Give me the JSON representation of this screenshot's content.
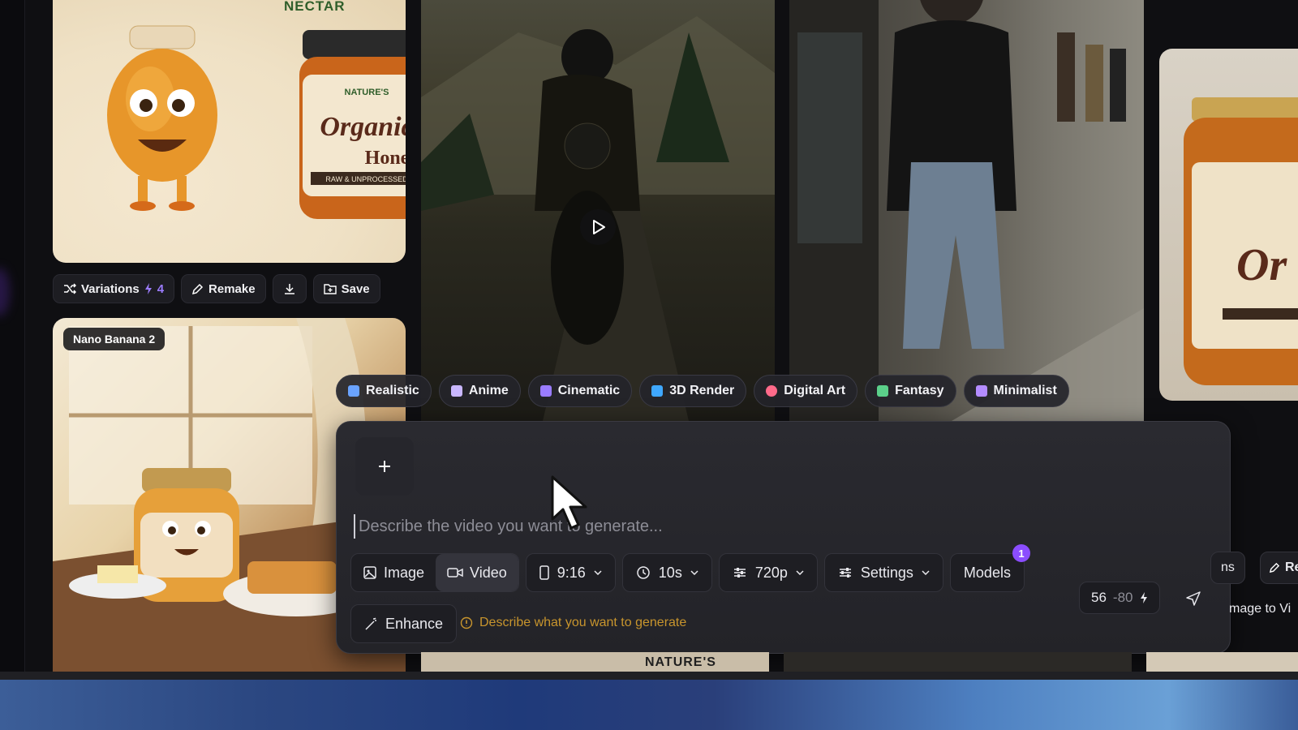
{
  "gallery": {
    "card1": {
      "brand": "NECTAR"
    },
    "card5": {
      "model_badge": "Nano Banana 2"
    }
  },
  "actions": {
    "variations_label": "Variations",
    "variations_count": "4",
    "remake_label": "Remake",
    "save_label": "Save"
  },
  "styles": [
    {
      "label": "Realistic",
      "color": "#6aa3ff"
    },
    {
      "label": "Anime",
      "color": "#c9b7ff"
    },
    {
      "label": "Cinematic",
      "color": "#9a7cff"
    },
    {
      "label": "3D Render",
      "color": "#3fa8ff"
    },
    {
      "label": "Digital Art",
      "color": "#ff6a8a"
    },
    {
      "label": "Fantasy",
      "color": "#5bd08a"
    },
    {
      "label": "Minimalist",
      "color": "#b48cff"
    }
  ],
  "composer": {
    "placeholder": "Describe the video you want to generate...",
    "mode_image": "Image",
    "mode_video": "Video",
    "aspect": "9:16",
    "duration": "10s",
    "resolution": "720p",
    "settings": "Settings",
    "models": "Models",
    "models_badge": "1",
    "credits": "56",
    "credit_cost": "-80",
    "enhance": "Enhance",
    "hint": "Describe what you want to generate"
  },
  "right_partial": {
    "a": "ns",
    "b": "Re",
    "c": "mage to Vi"
  },
  "bottom": {
    "brand": "NATURE'S"
  },
  "colors": {
    "accent": "#8b4dff",
    "hint": "#c8952d"
  }
}
